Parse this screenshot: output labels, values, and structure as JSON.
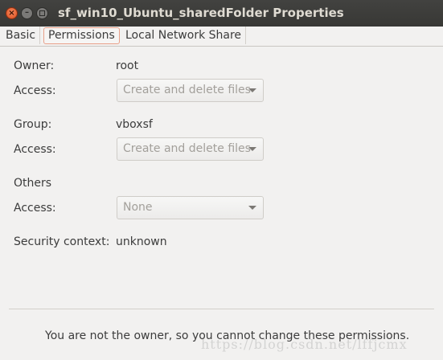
{
  "window": {
    "title": "sf_win10_Ubuntu_sharedFolder Properties",
    "close_glyph": "×",
    "minimize_glyph": "–"
  },
  "tabs": [
    {
      "label": "Basic"
    },
    {
      "label": "Permissions",
      "active": true
    },
    {
      "label": "Local Network Share"
    }
  ],
  "permissions": {
    "owner": {
      "label": "Owner:",
      "value": "root",
      "access_label": "Access:",
      "access_value": "Create and delete files"
    },
    "group": {
      "label": "Group:",
      "value": "vboxsf",
      "access_label": "Access:",
      "access_value": "Create and delete files"
    },
    "others": {
      "label": "Others",
      "access_label": "Access:",
      "access_value": "None"
    },
    "security_context": {
      "label": "Security context:",
      "value": "unknown"
    }
  },
  "notice": "You are not the owner, so you cannot change these permissions.",
  "watermark": "https://blog.csdn.net/lffjcmx",
  "colors": {
    "titlebar": "#3c3b37",
    "close_button": "#e9612d",
    "active_tab_border": "#e8a089",
    "background": "#f2f1f0"
  },
  "icons": [
    "close-icon",
    "minimize-icon",
    "maximize-icon",
    "dropdown-arrow-icon"
  ]
}
